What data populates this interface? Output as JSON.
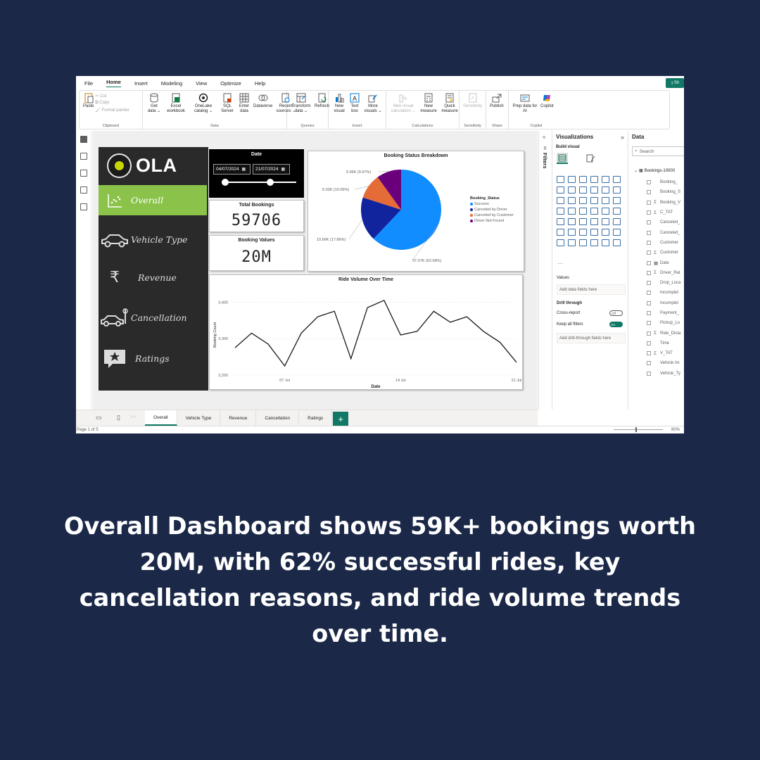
{
  "menu": {
    "tabs": [
      "File",
      "Home",
      "Insert",
      "Modeling",
      "View",
      "Optimize",
      "Help"
    ],
    "share": "Sh"
  },
  "ribbon": {
    "clipboard": {
      "paste": "Paste",
      "cut": "Cut",
      "copy": "Copy",
      "format_painter": "Format painter",
      "group": "Clipboard"
    },
    "data": {
      "get_data": "Get data ⌄",
      "excel": "Excel workbook",
      "onelake": "OneLake catalog ⌄",
      "sql": "SQL Server",
      "enter": "Enter data",
      "dataverse": "Dataverse",
      "recent": "Recent sources ⌄",
      "group": "Data"
    },
    "queries": {
      "transform": "Transform data ⌄",
      "refresh": "Refresh",
      "group": "Queries"
    },
    "insert": {
      "new_visual": "New visual",
      "text_box": "Text box",
      "more": "More visuals ⌄",
      "group": "Insert"
    },
    "calculations": {
      "new_visual_calc": "New visual calculation ⌄",
      "new_measure": "New measure",
      "quick_measure": "Quick measure",
      "group": "Calculations"
    },
    "sensitivity": {
      "label": "Sensitivity",
      "group": "Sensitivity"
    },
    "share": {
      "publish": "Publish",
      "group": "Share"
    },
    "copilot": {
      "prep": "Prep data for AI",
      "copilot": "Copilot",
      "group": "Copilot"
    }
  },
  "report": {
    "logo_text": "OLA",
    "nav": [
      "Overall",
      "Vehicle Type",
      "Revenue",
      "Cancellation",
      "Ratings"
    ],
    "date": {
      "title": "Date",
      "start": "04/07/2024",
      "end": "21/07/2024"
    },
    "total_bookings": {
      "title": "Total Bookings",
      "value": "59706"
    },
    "booking_values": {
      "title": "Booking Values",
      "value": "20M"
    }
  },
  "chart_data": [
    {
      "type": "pie",
      "title": "Booking Status Breakdown",
      "legend_title": "Booking_Status",
      "legend_position": "right",
      "slices": [
        {
          "name": "Success",
          "value": 37.07,
          "label": "37.07K (62.08%)",
          "color": "#118dff"
        },
        {
          "name": "Canceled by Driver",
          "value": 10.66,
          "label": "10.66K (17.86%)",
          "color": "#12239e"
        },
        {
          "name": "Canceled by Customer",
          "value": 6.03,
          "label": "6.03K (10.09%)",
          "color": "#e66c37"
        },
        {
          "name": "Driver Not Found",
          "value": 5.95,
          "label": "5.95K (9.97%)",
          "color": "#6b007b"
        }
      ]
    },
    {
      "type": "line",
      "title": "Ride Volume Over Time",
      "xlabel": "Date",
      "ylabel": "Booking Count",
      "x": [
        "2024-07-04",
        "2024-07-05",
        "2024-07-06",
        "2024-07-07",
        "2024-07-08",
        "2024-07-09",
        "2024-07-10",
        "2024-07-11",
        "2024-07-12",
        "2024-07-13",
        "2024-07-14",
        "2024-07-15",
        "2024-07-16",
        "2024-07-17",
        "2024-07-18",
        "2024-07-19",
        "2024-07-20",
        "2024-07-21"
      ],
      "values": [
        3275,
        3315,
        3285,
        3225,
        3315,
        3360,
        3375,
        3245,
        3385,
        3405,
        3310,
        3320,
        3375,
        3345,
        3360,
        3320,
        3290,
        3235
      ],
      "xticks": [
        "07 Jul",
        "14 Jul",
        "21 Jul"
      ],
      "yticks": [
        "3,400",
        "3,300",
        "3,200"
      ],
      "ylim": [
        3200,
        3420
      ],
      "grid": true
    }
  ],
  "panes": {
    "filters": "Filters",
    "visualizations": "Visualizations",
    "build_visual": "Build visual",
    "values_label": "Values",
    "values_placeholder": "Add data fields here",
    "drill_through": "Drill through",
    "cross_report": "Cross-report",
    "cross_report_state": "Off",
    "keep_filters": "Keep all filters",
    "keep_filters_state": "On",
    "drill_placeholder": "Add drill-through fields here",
    "data_title": "Data",
    "search_placeholder": "Search",
    "table_name": "Bookings-10000",
    "fields": [
      {
        "name": "Booking_",
        "sigma": ""
      },
      {
        "name": "Booking_S",
        "sigma": ""
      },
      {
        "name": "Booking_V",
        "sigma": "Σ"
      },
      {
        "name": "C_TAT",
        "sigma": "Σ"
      },
      {
        "name": "Canceled_",
        "sigma": ""
      },
      {
        "name": "Canceled_",
        "sigma": ""
      },
      {
        "name": "Customer",
        "sigma": ""
      },
      {
        "name": "Customer",
        "sigma": "Σ"
      },
      {
        "name": "Date",
        "sigma": "▦"
      },
      {
        "name": "Driver_Rat",
        "sigma": "Σ"
      },
      {
        "name": "Drop_Loca",
        "sigma": ""
      },
      {
        "name": "Incomplet",
        "sigma": ""
      },
      {
        "name": "Incomplet",
        "sigma": ""
      },
      {
        "name": "Payment_",
        "sigma": ""
      },
      {
        "name": "Pickup_Lo",
        "sigma": ""
      },
      {
        "name": "Ride_Dista",
        "sigma": "Σ"
      },
      {
        "name": "Time",
        "sigma": ""
      },
      {
        "name": "V_TAT",
        "sigma": "Σ"
      },
      {
        "name": "Vehicle Im",
        "sigma": ""
      },
      {
        "name": "Vehicle_Ty",
        "sigma": ""
      }
    ]
  },
  "pages": [
    "Overall",
    "Vehicle Type",
    "Revenue",
    "Cancellation",
    "Ratings"
  ],
  "add_page": "+",
  "status": {
    "page": "Page 1 of 5",
    "zoom": "80%"
  },
  "caption": "Overall Dashboard shows 59K+ bookings worth 20M, with 62% successful rides, key cancellation reasons, and ride volume trends over time."
}
